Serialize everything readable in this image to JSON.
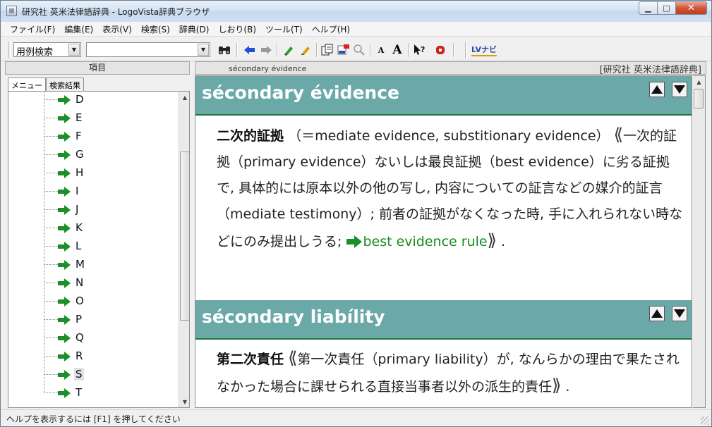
{
  "window": {
    "title": "研究社 英米法律語辞典 - LogoVista辞典ブラウザ",
    "buttons": {
      "minimize": "▁",
      "maximize": "□",
      "close": "✕"
    }
  },
  "menu": [
    "ファイル(F)",
    "編集(E)",
    "表示(V)",
    "検索(S)",
    "辞典(D)",
    "しおり(B)",
    "ツール(T)",
    "ヘルプ(H)"
  ],
  "toolbar": {
    "search_mode": "用例検索",
    "search_input": "",
    "icons": [
      "binoculars-icon",
      "back-arrow-icon",
      "forward-arrow-icon",
      "marker-icon",
      "pencil-icon",
      "copy-icon",
      "highlight-icon",
      "zoom-icon",
      "font-small-icon",
      "font-large-icon",
      "help-icon",
      "stop-icon",
      "lv-navi-icon"
    ],
    "font_small_label": "A",
    "font_large_label": "A",
    "lv_navi_label": "LVナビ"
  },
  "left_panel": {
    "header": "項目",
    "tabs": [
      "メニュー",
      "検索結果"
    ],
    "tree_items": [
      "D",
      "E",
      "F",
      "G",
      "H",
      "I",
      "J",
      "K",
      "L",
      "M",
      "N",
      "O",
      "P",
      "Q",
      "R",
      "S",
      "T"
    ],
    "selected": "S"
  },
  "right_panel": {
    "current_headword": "sécondary évidence",
    "dictionary_name": "[研究社 英米法律語辞典]",
    "entries": [
      {
        "headword": "sécondary évidence",
        "term": "二次的証拠",
        "alt": "（＝mediate evidence, substitionary evidence）",
        "open_bracket": "⟪",
        "definition": "一次的証拠（primary evidence）ないしは最良証拠（best evidence）に劣る証拠で, 具体的には原本以外の他の写し, 内容についての証言などの媒介的証言（mediate testimony）; 前者の証拠がなくなった時, 手に入れられない時などにのみ提出しうる;",
        "link": "best evidence rule",
        "close_bracket": "⟫",
        "end": "."
      },
      {
        "headword": "sécondary liabílity",
        "term": "第二次責任",
        "open_bracket": "⟪",
        "definition": "第一次責任（primary liability）が, なんらかの理由で果たされなかった場合に課せられる直接当事者以外の派生的責任",
        "close_bracket": "⟫",
        "end": "."
      }
    ]
  },
  "status_bar": {
    "message": "ヘルプを表示するには [F1] を押してください"
  },
  "colors": {
    "entry_header": "#6ba9a9",
    "link": "#1a8a1a",
    "arrow": "#1a8f2a"
  }
}
